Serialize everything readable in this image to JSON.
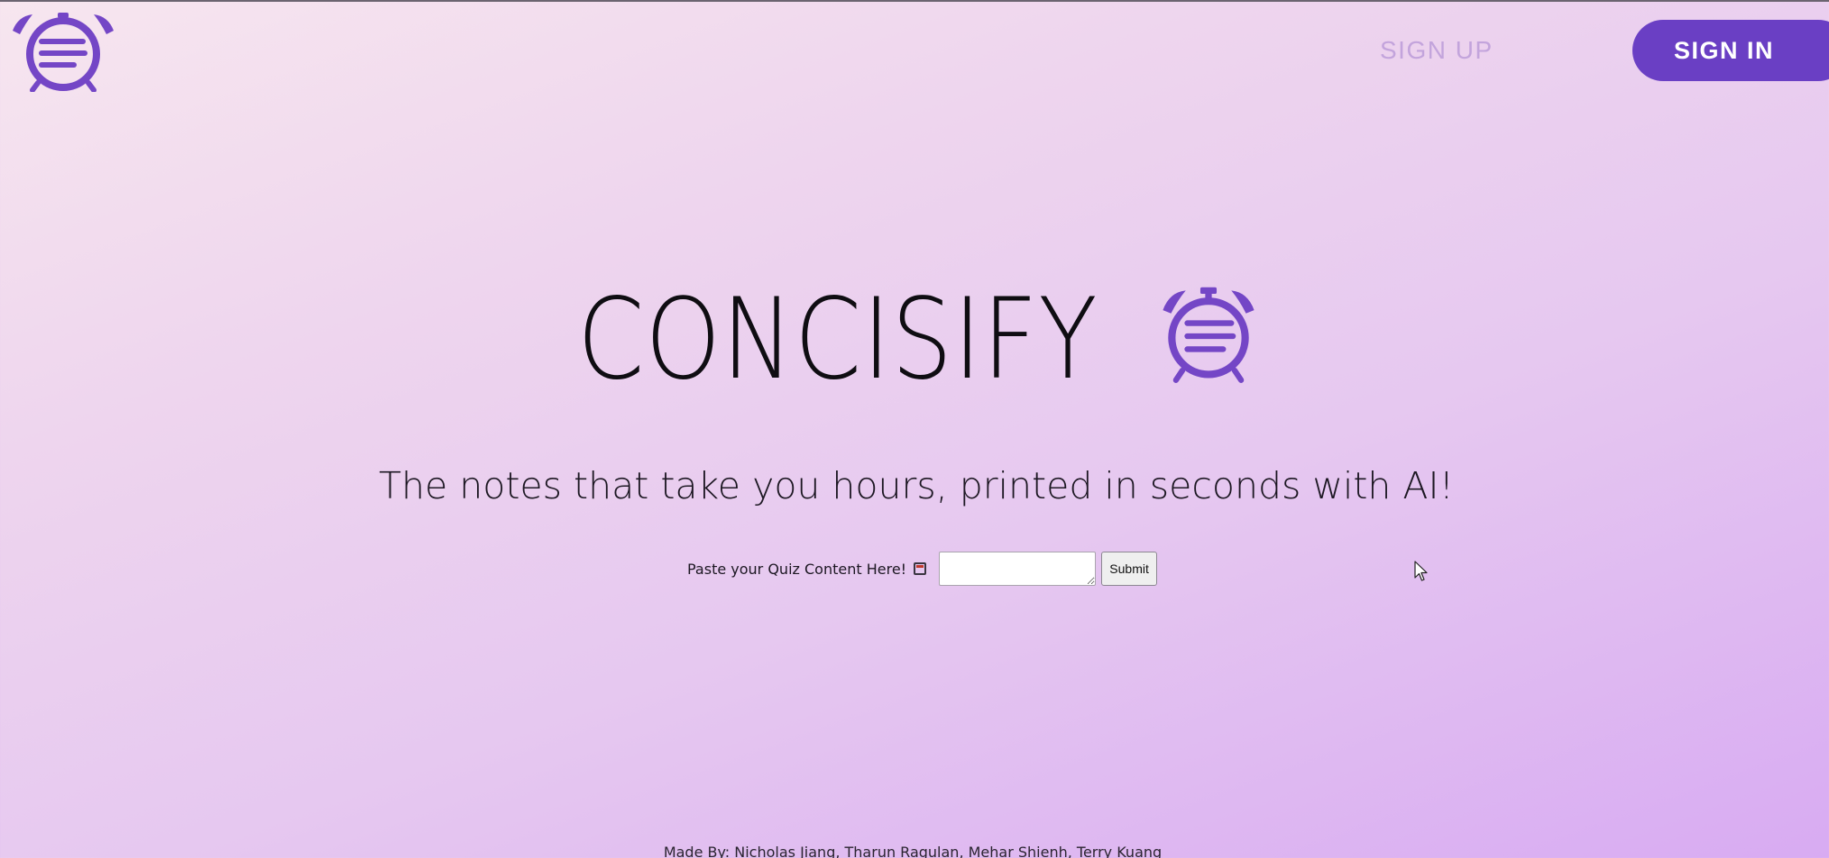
{
  "header": {
    "logo_icon": "alarm-clock-notes-icon",
    "signup_label": "SIGN UP",
    "signin_label": "SIGN IN"
  },
  "hero": {
    "title": "CONCISIFY",
    "logo_icon": "alarm-clock-notes-icon",
    "tagline": "The notes that take you hours, printed in seconds with AI!"
  },
  "quiz_form": {
    "label": "Paste your Quiz Content Here!",
    "label_icon": "calendar-emoji-icon",
    "input_value": "",
    "submit_label": "Submit"
  },
  "footer": {
    "credits": "Made By: Nicholas Jiang, Tharun Ragulan, Mehar Shienh, Terry Kuang"
  },
  "colors": {
    "brand_purple": "#6a3fc4",
    "signup_text": "#c3a4dc",
    "bg_start": "#f7e6ef",
    "bg_end": "#d8abf2"
  }
}
